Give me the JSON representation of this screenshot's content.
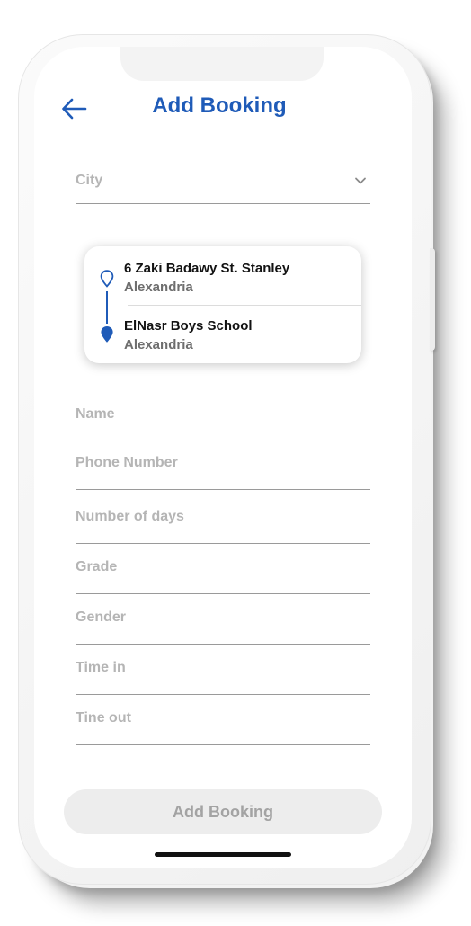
{
  "header": {
    "title": "Add Booking",
    "back_icon": "arrow-left-icon"
  },
  "city_select": {
    "label": "City",
    "icon": "chevron-down-icon"
  },
  "route": {
    "pickup": {
      "address": "6 Zaki Badawy St. Stanley",
      "city": "Alexandria",
      "icon": "location-pin-outline-icon"
    },
    "dropoff": {
      "address": "ElNasr Boys School",
      "city": "Alexandria",
      "icon": "location-pin-filled-icon"
    }
  },
  "form": {
    "name_placeholder": "Name",
    "phone_placeholder": "Phone Number",
    "days_placeholder": "Number of days",
    "grade_placeholder": "Grade",
    "gender_placeholder": "Gender",
    "time_in_placeholder": "Time in",
    "time_out_placeholder": "Tine out"
  },
  "submit": {
    "label": "Add Booking"
  },
  "colors": {
    "primary": "#1f5bb8",
    "placeholder": "#b5b5b5",
    "button_bg": "#ededed",
    "button_text": "#a3a3a3"
  }
}
